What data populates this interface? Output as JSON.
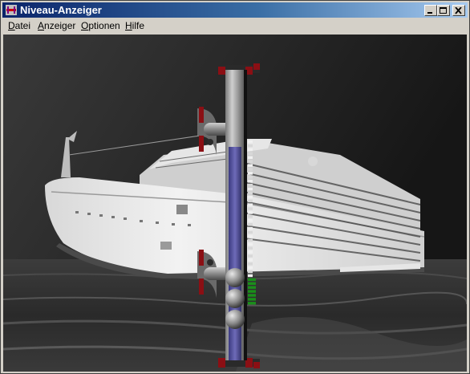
{
  "window": {
    "title": "Niveau-Anzeiger",
    "icon": "level-gauge-app-icon",
    "controls": [
      "minimize-icon",
      "maximize-icon",
      "close-icon"
    ]
  },
  "menu": [
    {
      "mnemonic": "D",
      "rest": "atei"
    },
    {
      "mnemonic": "A",
      "rest": "nzeiger"
    },
    {
      "mnemonic": "O",
      "rest": "ptionen"
    },
    {
      "mnemonic": "H",
      "rest": "ilfe"
    }
  ],
  "level_indicator": {
    "floats": 3,
    "scale_segments": 42,
    "active_marker_color": "#1a8f1a",
    "tube_color": "#5a57a0",
    "flange_color": "#8b0f14"
  },
  "background_image": "grayscale-cruise-ship-at-sea"
}
